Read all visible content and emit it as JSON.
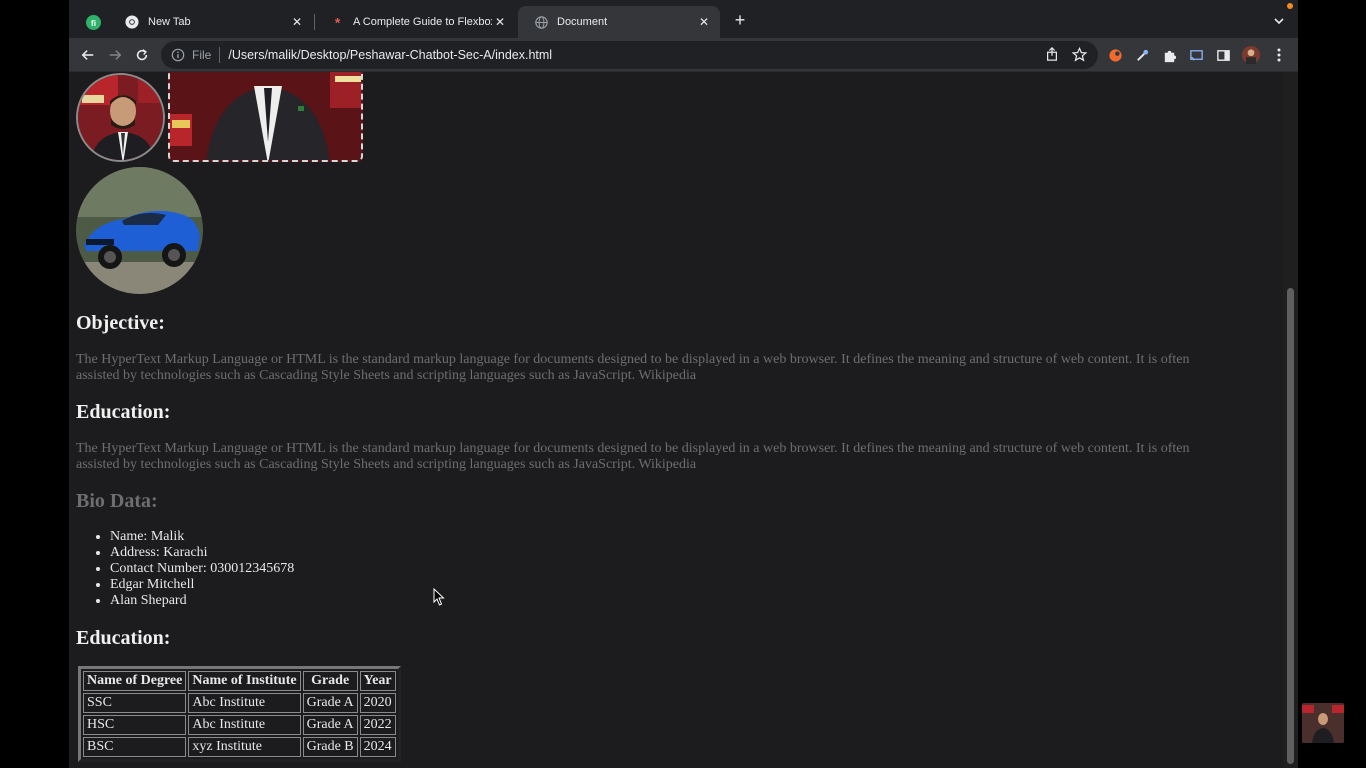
{
  "tabs": [
    {
      "title": "New Tab",
      "icon": "chrome-icon",
      "active": false
    },
    {
      "title": "A Complete Guide to Flexbox |",
      "icon": "css-tricks-icon",
      "active": false
    },
    {
      "title": "Document",
      "icon": "globe-icon",
      "active": true
    }
  ],
  "omnibox": {
    "scheme_label": "File",
    "url": "/Users/malik/Desktop/Peshawar-Chatbot-Sec-A/index.html"
  },
  "page": {
    "objective_heading": "Objective:",
    "objective_text": "The HyperText Markup Language or HTML is the standard markup language for documents designed to be displayed in a web browser. It defines the meaning and structure of web content. It is often assisted by technologies such as Cascading Style Sheets and scripting languages such as JavaScript. Wikipedia",
    "education_heading": "Education:",
    "education_text": "The HyperText Markup Language or HTML is the standard markup language for documents designed to be displayed in a web browser. It defines the meaning and structure of web content. It is often assisted by technologies such as Cascading Style Sheets and scripting languages such as JavaScript. Wikipedia",
    "bio_heading": "Bio Data:",
    "bio_items": [
      "Name: Malik",
      "Address: Karachi",
      "Contact Number: 030012345678",
      "Edgar Mitchell",
      "Alan Shepard"
    ],
    "education_table_heading": "Education:",
    "table": {
      "headers": [
        "Name of Degree",
        "Name of Institute",
        "Grade",
        "Year"
      ],
      "rows": [
        [
          "SSC",
          "Abc Institute",
          "Grade A",
          "2020"
        ],
        [
          "HSC",
          "Abc Institute",
          "Grade A",
          "2022"
        ],
        [
          "BSC",
          "xyz Institute",
          "Grade B",
          "2024"
        ]
      ]
    }
  },
  "colors": {
    "browser_frame": "#202124",
    "toolbar": "#35363a",
    "page_background": "#1c1c1e",
    "muted_text": "#6e6e6e"
  }
}
